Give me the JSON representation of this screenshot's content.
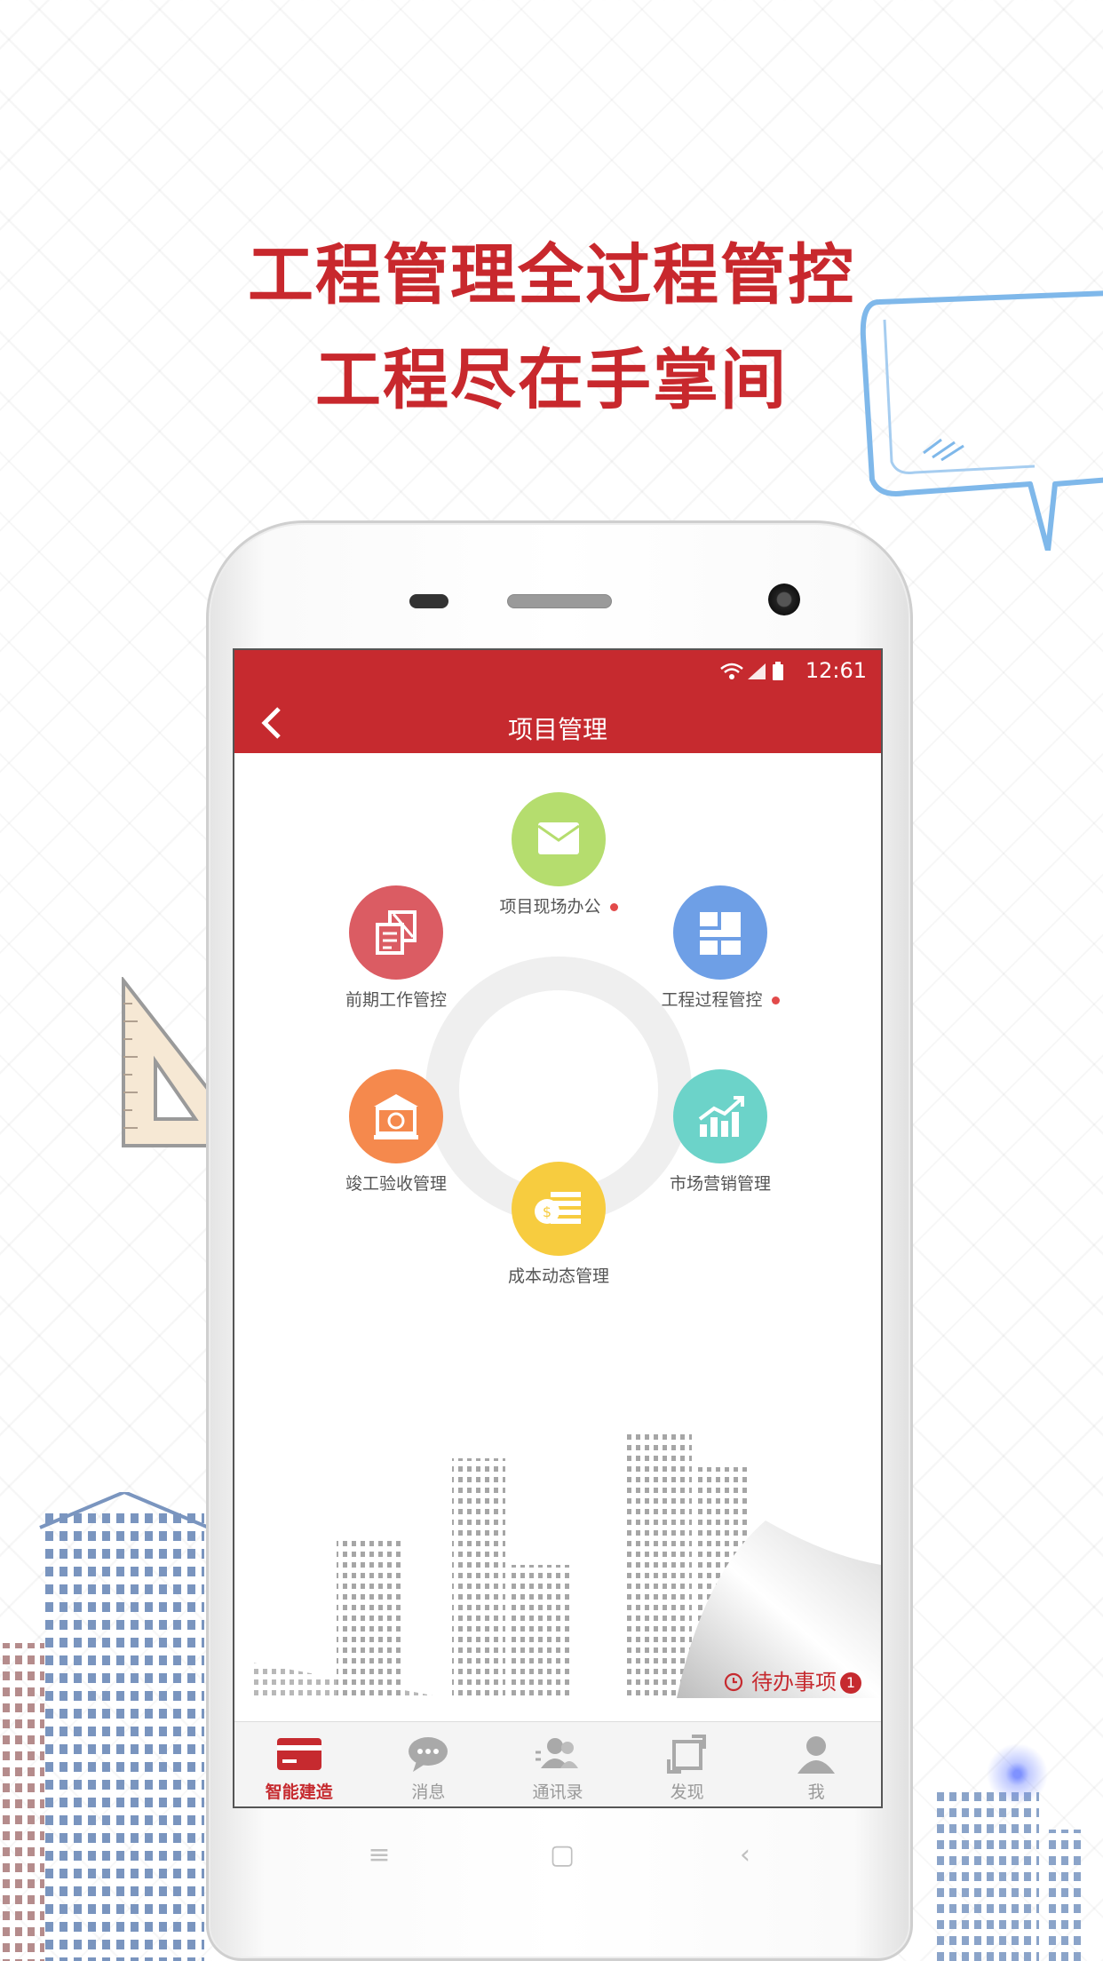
{
  "promo": {
    "headline_1": "工程管理全过程管控",
    "headline_2": "工程尽在手掌间"
  },
  "status_bar": {
    "time": "12:61",
    "icons": [
      "wifi-icon",
      "signal-icon",
      "battery-icon"
    ]
  },
  "header": {
    "title": "项目管理",
    "back_icon": "chevron-left-icon"
  },
  "modules": [
    {
      "label": "项目现场办公",
      "icon": "envelope-icon",
      "color": "#b5dd6e",
      "has_dot": true
    },
    {
      "label": "工程过程管控",
      "icon": "blocks-icon",
      "color": "#6e9fe6",
      "has_dot": true
    },
    {
      "label": "市场营销管理",
      "icon": "trend-chart-icon",
      "color": "#6cd3c9",
      "has_dot": false
    },
    {
      "label": "成本动态管理",
      "icon": "coin-stack-icon",
      "color": "#f7cc3f",
      "has_dot": false
    },
    {
      "label": "竣工验收管理",
      "icon": "institution-icon",
      "color": "#f5894d",
      "has_dot": false
    },
    {
      "label": "前期工作管控",
      "icon": "documents-icon",
      "color": "#db5c63",
      "has_dot": false
    }
  ],
  "todo": {
    "label": "待办事项",
    "count": "1",
    "icon": "clock-icon"
  },
  "tabs": [
    {
      "label": "智能建造",
      "icon": "card-icon",
      "active": true
    },
    {
      "label": "消息",
      "icon": "chat-bubble-icon",
      "active": false
    },
    {
      "label": "通讯录",
      "icon": "contacts-icon",
      "active": false
    },
    {
      "label": "发现",
      "icon": "discover-icon",
      "active": false
    },
    {
      "label": "我",
      "icon": "person-icon",
      "active": false
    }
  ],
  "colors": {
    "brand_red": "#c62a2f",
    "headline_red": "#c8282d"
  }
}
